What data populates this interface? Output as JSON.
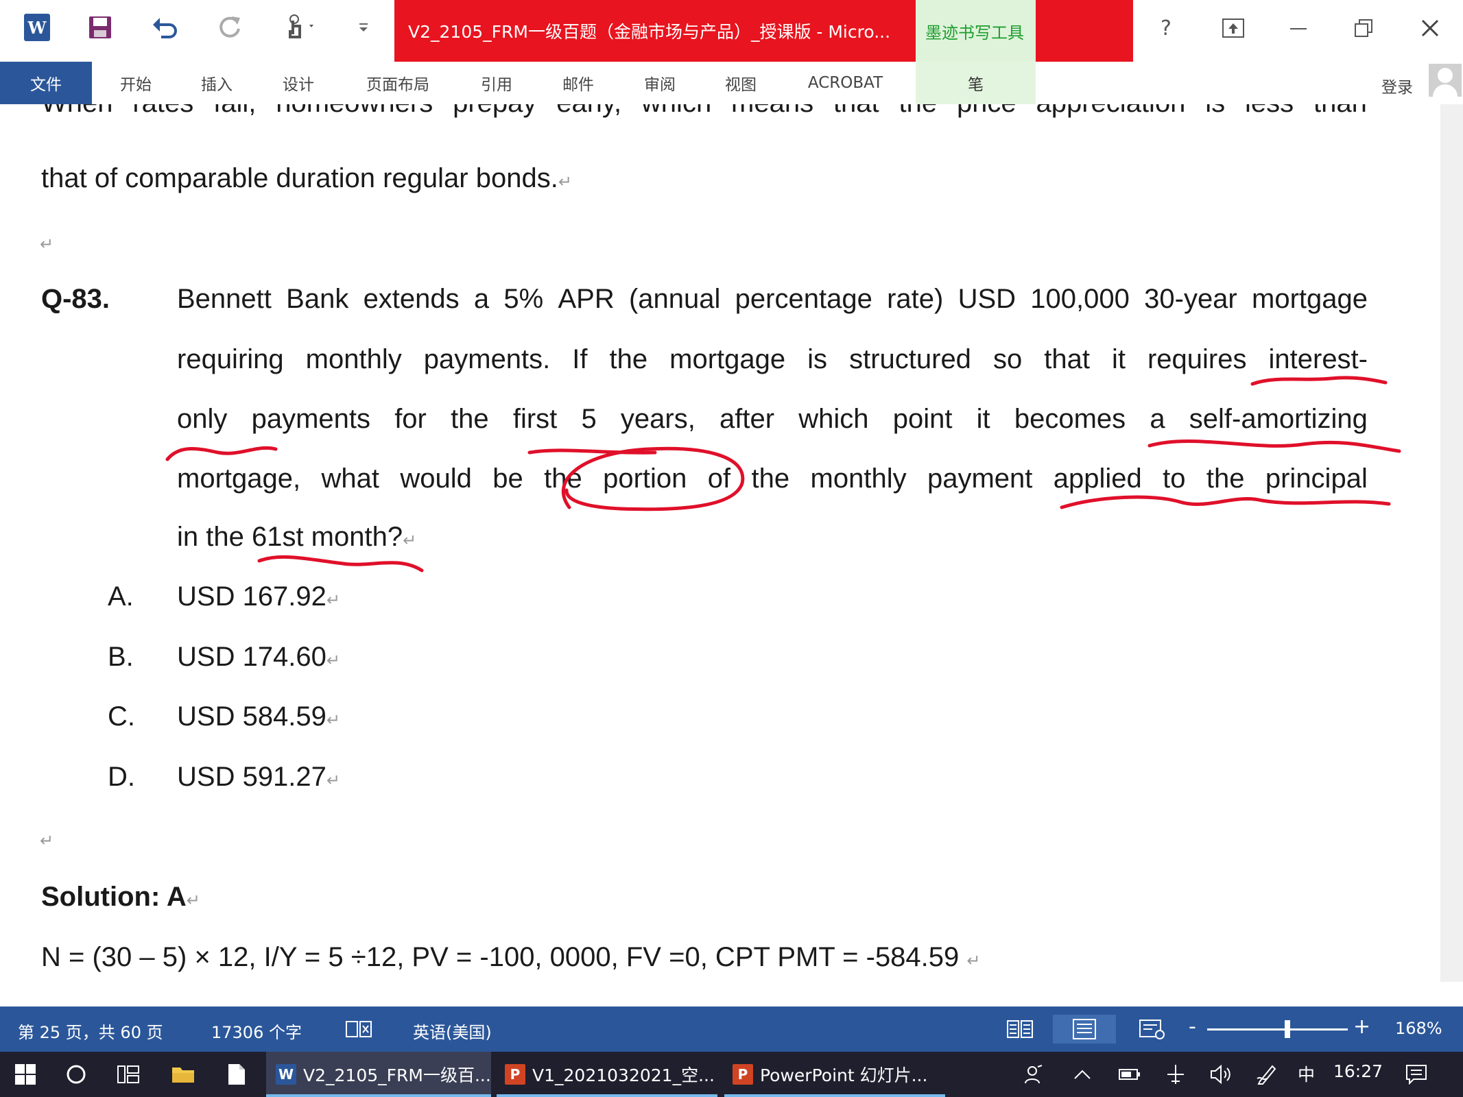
{
  "window": {
    "title": "V2_2105_FRM一级百题（金融市场与产品）_授课版 - Micro...",
    "ink_tools_label": "墨迹书写工具",
    "login_label": "登录"
  },
  "ribbon": {
    "tabs": [
      "文件",
      "开始",
      "插入",
      "设计",
      "页面布局",
      "引用",
      "邮件",
      "审阅",
      "视图",
      "ACROBAT",
      "笔"
    ]
  },
  "document": {
    "intro_line1": "When rates fall, homeowners prepay early, which means that the price appreciation is less than",
    "intro_line2": "that of comparable duration regular bonds.",
    "question_number": "Q-83.",
    "question_lines": [
      "Bennett Bank extends a 5% APR (annual percentage rate) USD 100,000 30-year mortgage",
      "requiring monthly payments. If the mortgage is structured so that it requires interest-",
      "only payments for the first 5 years, after which point it becomes a self-amortizing",
      "mortgage, what would be the portion of the monthly payment applied to the principal",
      "in the 61st month?"
    ],
    "options": [
      {
        "letter": "A.",
        "text": "USD 167.92"
      },
      {
        "letter": "B.",
        "text": "USD 174.60"
      },
      {
        "letter": "C.",
        "text": "USD 584.59"
      },
      {
        "letter": "D.",
        "text": "USD 591.27"
      }
    ],
    "solution_label": "Solution: A",
    "solution_line": "N = (30 – 5) × 12, I/Y = 5 ÷12, PV = -100, 0000, FV =0, CPT PMT = -584.59",
    "paragraph_mark": "↵"
  },
  "status_bar": {
    "page_info": "第 25 页，共 60 页",
    "word_count": "17306 个字",
    "language": "英语(美国)",
    "zoom_minus": "-",
    "zoom_plus": "+",
    "zoom_level": "168%",
    "zoom_fraction": 0.57
  },
  "taskbar": {
    "apps": [
      {
        "badge": "W",
        "label": "V2_2105_FRM一级百...",
        "color": "#2b579a"
      },
      {
        "badge": "P",
        "label": "V1_2021032021_空...",
        "color": "#d04423"
      },
      {
        "badge": "P",
        "label": "PowerPoint 幻灯片...",
        "color": "#d04423"
      }
    ],
    "ime": "中",
    "time": "16:27"
  },
  "colors": {
    "accent": "#2b579a",
    "title_red": "#e8141f",
    "ink_red": "#e0102a",
    "ink_tab_green": "#1e9d2e"
  }
}
